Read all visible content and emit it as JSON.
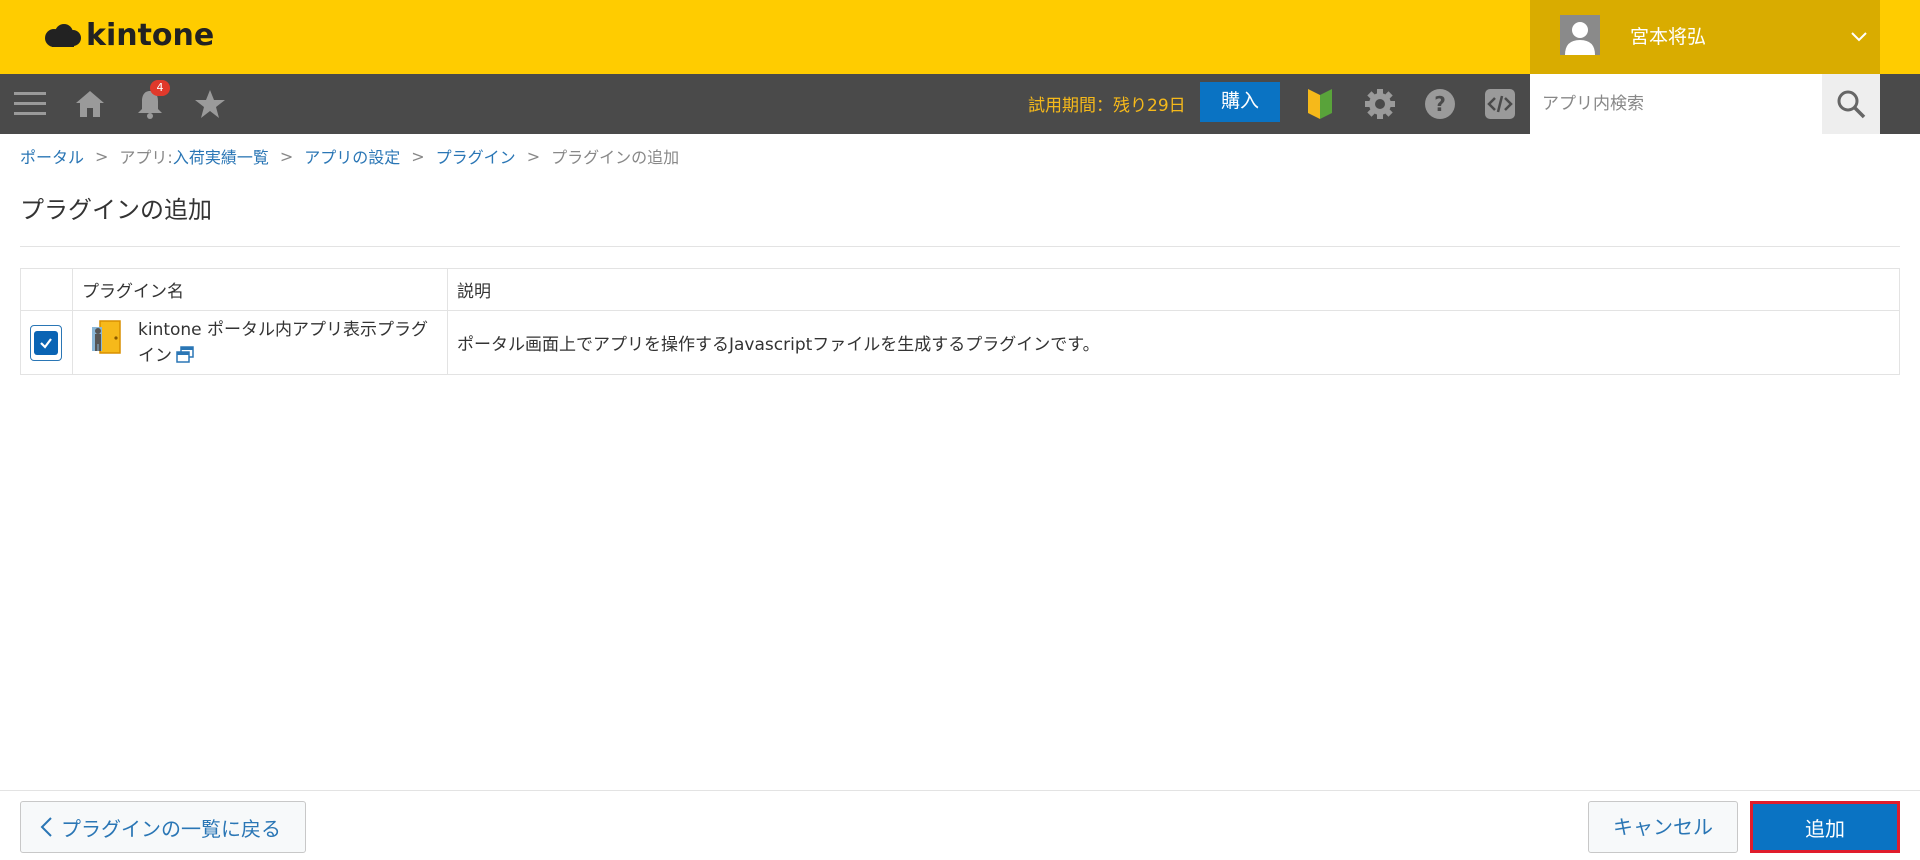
{
  "header": {
    "logo_text": "kintone",
    "user_name": "宮本将弘"
  },
  "toolbar": {
    "notification_count": "4",
    "trial_text": "試用期間：残り29日",
    "buy_label": "購入",
    "search_placeholder": "アプリ内検索"
  },
  "breadcrumb": {
    "portal": "ポータル",
    "app_prefix": "アプリ: ",
    "app_name": "入荷実績一覧",
    "app_settings": "アプリの設定",
    "plugins": "プラグイン",
    "current": "プラグインの追加",
    "separator": ">"
  },
  "page_title": "プラグインの追加",
  "table": {
    "headers": {
      "name": "プラグイン名",
      "description": "説明"
    },
    "rows": [
      {
        "checked": true,
        "name": "kintone ポータル内アプリ表示プラグイン",
        "description": "ポータル画面上でアプリを操作するJavascriptファイルを生成するプラグインです。"
      }
    ]
  },
  "footer": {
    "back_label": "プラグインの一覧に戻る",
    "cancel_label": "キャンセル",
    "add_label": "追加"
  },
  "colors": {
    "header_bg": "#ffcc00",
    "toolbar_bg": "#4a4a4a",
    "accent_blue": "#0a73c3",
    "link_blue": "#2a76b5",
    "highlight_red": "#e01d2c"
  }
}
